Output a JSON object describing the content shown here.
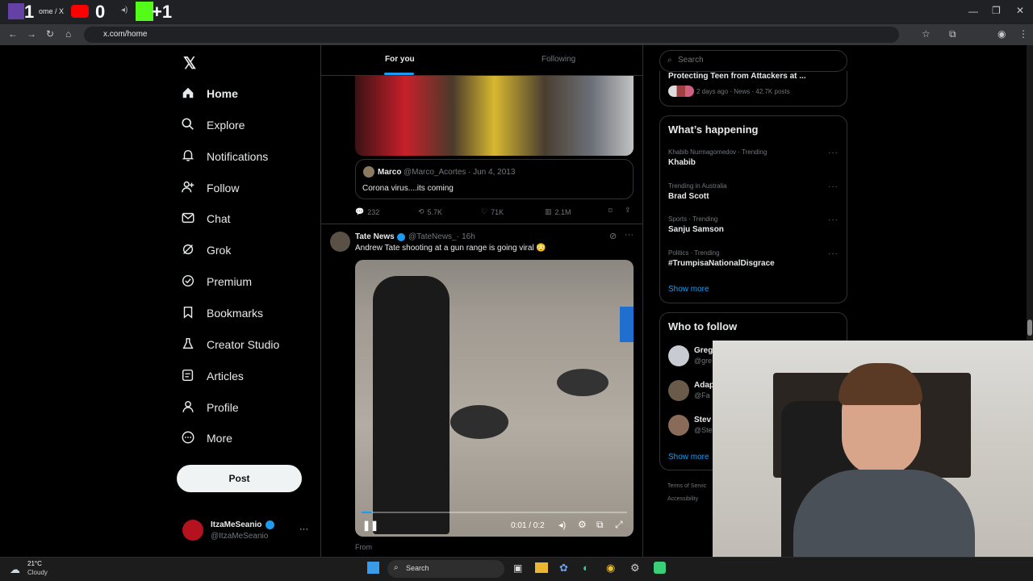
{
  "browser": {
    "tab_title": "ome / X",
    "overlay_count_left": "1",
    "overlay_count_mid": "0",
    "overlay_count_right": "+1",
    "url": "x.com/home"
  },
  "nav": {
    "items": [
      {
        "label": "Home",
        "icon": "home-icon"
      },
      {
        "label": "Explore",
        "icon": "search-icon"
      },
      {
        "label": "Notifications",
        "icon": "bell-icon"
      },
      {
        "label": "Follow",
        "icon": "add-user-icon"
      },
      {
        "label": "Chat",
        "icon": "mail-icon"
      },
      {
        "label": "Grok",
        "icon": "grok-icon"
      },
      {
        "label": "Premium",
        "icon": "verified-icon"
      },
      {
        "label": "Bookmarks",
        "icon": "bookmark-icon"
      },
      {
        "label": "Creator Studio",
        "icon": "flask-icon"
      },
      {
        "label": "Articles",
        "icon": "article-icon"
      },
      {
        "label": "Profile",
        "icon": "person-icon"
      },
      {
        "label": "More",
        "icon": "more-circle-icon"
      }
    ],
    "post_label": "Post"
  },
  "account": {
    "name": "ItzaMeSeanio",
    "handle": "@ItzaMeSeanio",
    "menu": "···"
  },
  "feed": {
    "tabs": [
      "For you",
      "Following"
    ],
    "quoted": {
      "name": "Marco",
      "handle": "@Marco_Acortes",
      "date": "· Jun 4, 2013",
      "text": "Corona virus....its coming"
    },
    "stats": {
      "replies": "232",
      "reposts": "5.7K",
      "likes": "71K",
      "views": "2.1M"
    },
    "post": {
      "name": "Tate News",
      "handle": "@TateNews_",
      "time": "· 16h",
      "text": "Andrew Tate shooting at a gun range is going viral 😳",
      "video_time": "0:01 / 0:2",
      "from_label": "From"
    }
  },
  "sidebar": {
    "search_placeholder": "Search",
    "top_news": {
      "title": "Protecting Teen from Attackers at ...",
      "meta": "2 days ago · News · 42.7K posts"
    },
    "happening_title": "What’s happening",
    "trends": [
      {
        "meta": "Khabib Nurmagomedov · Trending",
        "title": "Khabib"
      },
      {
        "meta": "Trending in Australia",
        "title": "Brad Scott"
      },
      {
        "meta": "Sports · Trending",
        "title": "Sanju Samson"
      },
      {
        "meta": "Politics · Trending",
        "title": "#TrumpisaNationalDisgrace"
      }
    ],
    "show_more": "Show more",
    "follow_title": "Who to follow",
    "follow": [
      {
        "name": "Greg",
        "handle": "@gre"
      },
      {
        "name": "Adap",
        "handle": "@Fa"
      },
      {
        "name": "Stev",
        "handle": "@Ste"
      }
    ],
    "follow_show_more": "Show more",
    "footer": [
      "Terms of Servic",
      "Accessibility"
    ]
  },
  "taskbar": {
    "temp": "21°C",
    "weather": "Cloudy",
    "search": "Search"
  },
  "colors": {
    "accent": "#1d9bf0",
    "background": "#000000",
    "border": "#2f3336"
  }
}
